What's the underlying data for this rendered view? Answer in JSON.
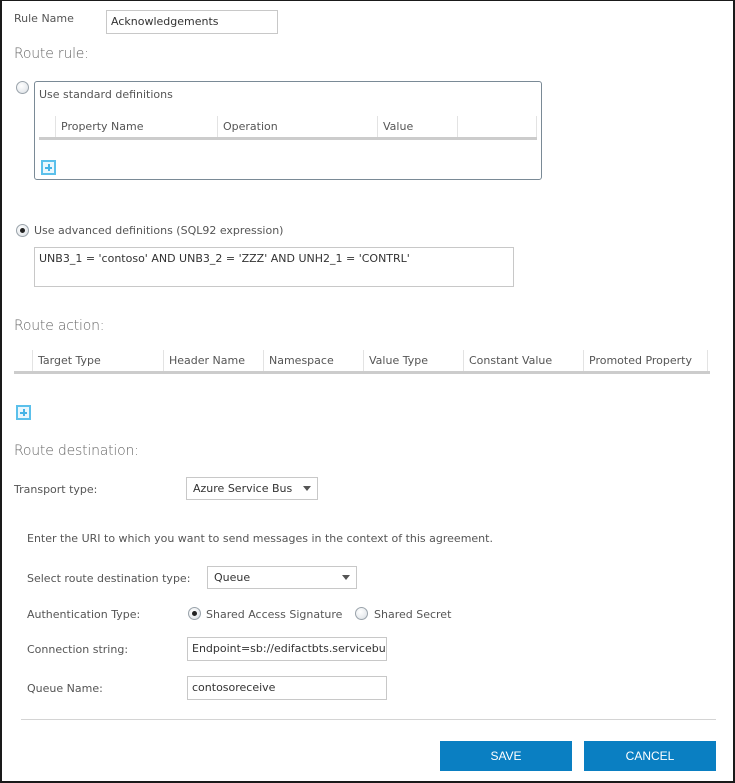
{
  "rule_name": {
    "label": "Rule Name",
    "value": "Acknowledgements"
  },
  "route_rule": {
    "title": "Route rule:",
    "standard": {
      "label": "Use standard definitions",
      "selected": false,
      "columns": [
        "Property Name",
        "Operation",
        "Value",
        ""
      ],
      "add_icon": "add-icon"
    },
    "advanced": {
      "label": "Use advanced definitions (SQL92 expression)",
      "selected": true,
      "expression": "UNB3_1 = 'contoso' AND UNB3_2 = 'ZZZ' AND UNH2_1 = 'CONTRL'"
    }
  },
  "route_action": {
    "title": "Route action:",
    "columns": [
      "Target Type",
      "Header Name",
      "Namespace",
      "Value Type",
      "Constant Value",
      "Promoted Property"
    ],
    "add_icon": "add-icon"
  },
  "route_destination": {
    "title": "Route destination:",
    "transport_type": {
      "label": "Transport type:",
      "value": "Azure Service Bus"
    },
    "description": "Enter the URI to which you want to send messages in the context of this agreement.",
    "destination_type": {
      "label": "Select route destination type:",
      "value": "Queue"
    },
    "authentication": {
      "label": "Authentication Type:",
      "options": [
        {
          "label": "Shared Access Signature",
          "selected": true
        },
        {
          "label": "Shared Secret",
          "selected": false
        }
      ]
    },
    "connection_string": {
      "label": "Connection string:",
      "value": "Endpoint=sb://edifactbts.servicebu"
    },
    "queue_name": {
      "label": "Queue Name:",
      "value": "contosoreceive"
    }
  },
  "footer": {
    "save_label": "SAVE",
    "cancel_label": "CANCEL"
  },
  "colors": {
    "primary_button": "#0a7fc2",
    "add_icon": "#5bc0eb"
  }
}
